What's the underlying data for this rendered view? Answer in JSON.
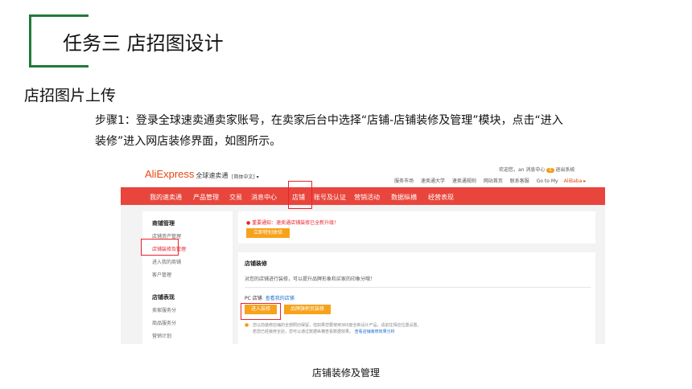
{
  "slide": {
    "title": "任务三 店招图设计",
    "section": "店招图片上传",
    "step_line1": "步骤1：登录全球速卖通卖家账号，在卖家后台中选择“店铺-店铺装修及管理”模块，点击“进入",
    "step_line2": "装修”进入网店装修界面，如图所示。",
    "caption": "店铺装修及管理",
    "accent_color": "#1f7a3a"
  },
  "screenshot": {
    "logo": "AliExpress",
    "logo_cn": "全球速卖通",
    "lang": "[简体中文] ▾",
    "welcome": "欢迎您，an  消息中心",
    "msg_count": "0",
    "logout": "退出系统",
    "top_links": [
      "服务市场",
      "速卖通大学",
      "速卖通规则",
      "网站首页",
      "联系客服",
      "Go to My"
    ],
    "top_link_brand": "AliBaba ▸",
    "nav": [
      "我的速卖通",
      "产品管理",
      "交易",
      "消息中心",
      "店铺",
      "账号及认证",
      "营销活动",
      "数据纵横",
      "经营表现"
    ],
    "nav_color": "#e8453c",
    "sidebar": {
      "group1": "商铺管理",
      "group1_items": [
        "店铺资产管理",
        "店铺装修及管理",
        "进入我的商铺",
        "客户管理"
      ],
      "group2": "店铺表现",
      "group2_items": [
        "卖家服务分",
        "商品服务分",
        "营销计划"
      ]
    },
    "notice": "重要通知：速卖通店铺装修已全新升级！",
    "notice_button": "立即特别体验",
    "decor_title": "店铺装修",
    "decor_desc": "对您的店铺进行装修，可以提升品牌形象和买家的印象分哦！",
    "pc_label": "PC 店铺",
    "pc_link": "查看我的店铺",
    "enter_button": "进入装修",
    "second_button": "品牌旗帜页装修",
    "tip_line1": "您以前装修店铺的全部照旧保留，但如果您要使用360度全新设计产品，请前往相应位置设置。",
    "tip_line2": "若您已经装修全店，您可以通过数据纵横查看数据效果。",
    "tip_link": "查看店铺装修效果分析"
  }
}
